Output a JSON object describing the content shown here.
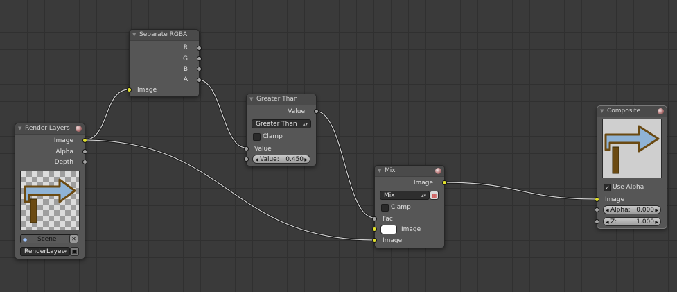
{
  "nodes": {
    "separate_rgba": {
      "title": "Separate RGBA",
      "outputs": [
        "R",
        "G",
        "B",
        "A"
      ],
      "input": "Image"
    },
    "render_layers": {
      "title": "Render Layers",
      "outputs": [
        "Image",
        "Alpha",
        "Depth"
      ],
      "scene": "Scene",
      "layer": "RenderLayer"
    },
    "greater_than": {
      "title": "Greater Than",
      "output": "Value",
      "operation": "Greater Than",
      "clamp_label": "Clamp",
      "input_value_label": "Value",
      "value_field_label": "Value:",
      "value_field_value": "0.450"
    },
    "mix": {
      "title": "Mix",
      "output": "Image",
      "blend": "Mix",
      "clamp_label": "Clamp",
      "inputs": [
        "Fac",
        "Image",
        "Image"
      ]
    },
    "composite": {
      "title": "Composite",
      "use_alpha_label": "Use Alpha",
      "input_image": "Image",
      "alpha_label": "Alpha:",
      "alpha_value": "0.000",
      "z_label": "Z:",
      "z_value": "1.000"
    }
  },
  "colors": {
    "background": "#3a3a3a",
    "node_body": "#565656",
    "socket_color": "#e2e22c",
    "socket_value": "#a3a3a3",
    "wire": "#d0d0d0"
  }
}
